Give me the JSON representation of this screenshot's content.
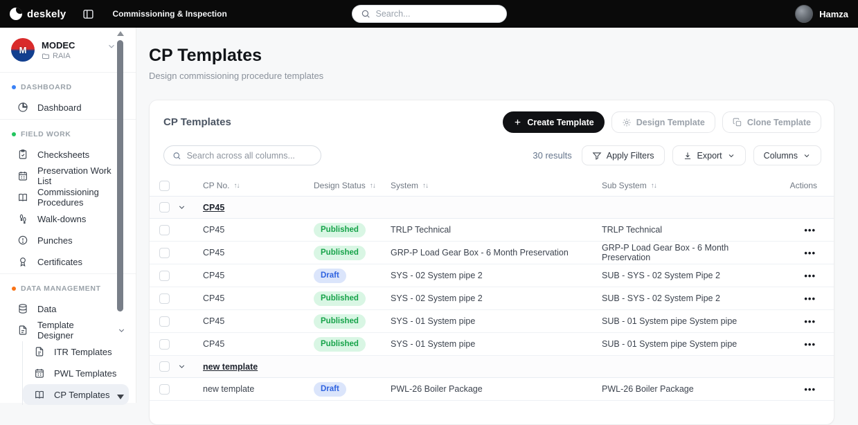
{
  "topbar": {
    "logo_text": "deskely",
    "app_title": "Commissioning & Inspection",
    "search_placeholder": "Search...",
    "user_name": "Hamza"
  },
  "sidebar": {
    "org_name": "MODEC",
    "org_project": "RAIA",
    "sections": [
      {
        "label": "DASHBOARD",
        "dot_color": "#3b82f6",
        "items": [
          {
            "label": "Dashboard",
            "icon": "pie-chart-icon"
          }
        ]
      },
      {
        "label": "FIELD WORK",
        "dot_color": "#22c55e",
        "items": [
          {
            "label": "Checksheets",
            "icon": "clipboard-icon"
          },
          {
            "label": "Preservation Work List",
            "icon": "calendar-icon"
          },
          {
            "label": "Commissioning Procedures",
            "icon": "book-icon"
          },
          {
            "label": "Walk-downs",
            "icon": "footprints-icon"
          },
          {
            "label": "Punches",
            "icon": "alert-circle-icon"
          },
          {
            "label": "Certificates",
            "icon": "award-icon"
          }
        ]
      },
      {
        "label": "DATA MANAGEMENT",
        "dot_color": "#f97316",
        "items": [
          {
            "label": "Data",
            "icon": "database-icon",
            "trailing": "chevron-right-icon"
          },
          {
            "label": "Template Designer",
            "icon": "file-icon",
            "trailing": "chevron-down-icon",
            "children": [
              {
                "label": "ITR Templates",
                "icon": "file-icon"
              },
              {
                "label": "PWL Templates",
                "icon": "calendar-icon"
              },
              {
                "label": "CP Templates",
                "icon": "book-icon",
                "active": true
              }
            ]
          }
        ]
      }
    ]
  },
  "page": {
    "title": "CP Templates",
    "subtitle": "Design commissioning procedure templates"
  },
  "card": {
    "title": "CP Templates",
    "create_label": "Create Template",
    "design_label": "Design Template",
    "clone_label": "Clone Template",
    "search_placeholder": "Search across all columns...",
    "results_text": "30 results",
    "apply_filters_label": "Apply Filters",
    "export_label": "Export",
    "columns_label": "Columns"
  },
  "table": {
    "headers": {
      "cp_no": "CP No.",
      "status": "Design Status",
      "system": "System",
      "sub_system": "Sub System",
      "actions": "Actions"
    },
    "sort_glyph": "↑↓",
    "status_styles": {
      "Published": {
        "bg": "#d9f6e4",
        "text": "#17a34a"
      },
      "Draft": {
        "bg": "#dbe5fb",
        "text": "#2f63e0"
      }
    },
    "groups": [
      {
        "name": "CP45",
        "rows": [
          {
            "cp_no": "CP45",
            "status": "Published",
            "system": "TRLP Technical",
            "sub_system": "TRLP Technical"
          },
          {
            "cp_no": "CP45",
            "status": "Published",
            "system": "GRP-P Load Gear Box - 6 Month Preservation",
            "sub_system": "GRP-P Load Gear Box - 6 Month Preservation"
          },
          {
            "cp_no": "CP45",
            "status": "Draft",
            "system": "SYS - 02 System pipe 2",
            "sub_system": "SUB - SYS - 02 System Pipe 2"
          },
          {
            "cp_no": "CP45",
            "status": "Published",
            "system": "SYS - 02 System pipe 2",
            "sub_system": "SUB - SYS - 02 System Pipe 2"
          },
          {
            "cp_no": "CP45",
            "status": "Published",
            "system": "SYS - 01 System pipe",
            "sub_system": "SUB - 01 System pipe System pipe"
          },
          {
            "cp_no": "CP45",
            "status": "Published",
            "system": "SYS - 01 System pipe",
            "sub_system": "SUB - 01 System pipe System pipe"
          }
        ]
      },
      {
        "name": "new template",
        "rows": [
          {
            "cp_no": "new template",
            "status": "Draft",
            "system": "PWL-26 Boiler Package",
            "sub_system": "PWL-26 Boiler Package"
          }
        ]
      }
    ]
  }
}
